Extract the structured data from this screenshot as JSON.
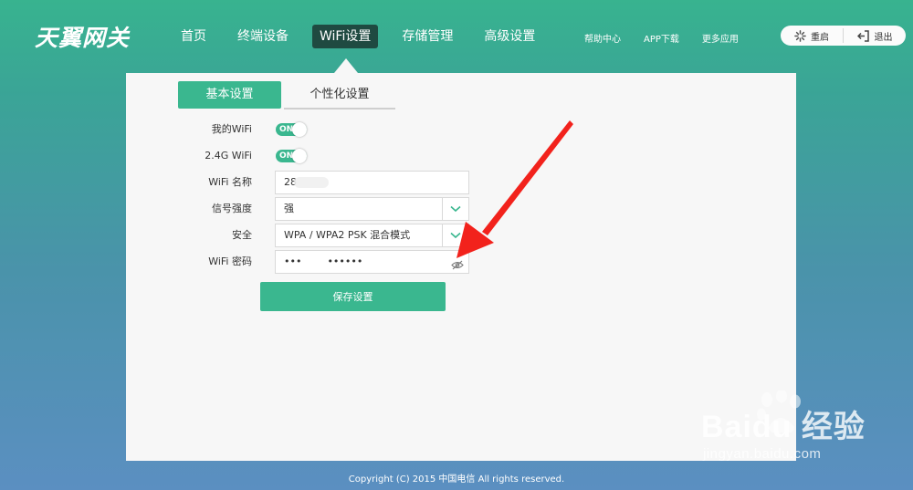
{
  "brand": {
    "logo_text": "天翼网关"
  },
  "nav": {
    "items": [
      {
        "label": "首页"
      },
      {
        "label": "终端设备"
      },
      {
        "label": "WiFi设置"
      },
      {
        "label": "存储管理"
      },
      {
        "label": "高级设置"
      }
    ],
    "active_index": 2
  },
  "top_links": [
    {
      "label": "帮助中心"
    },
    {
      "label": "APP下载"
    },
    {
      "label": "更多应用"
    }
  ],
  "actions": {
    "restart": {
      "label": "重启",
      "icon": "spinner-icon"
    },
    "logout": {
      "label": "退出",
      "icon": "logout-icon"
    }
  },
  "tabs": [
    {
      "label": "基本设置",
      "active": true
    },
    {
      "label": "个性化设置",
      "active": false
    }
  ],
  "form": {
    "my_wifi": {
      "label": "我的WiFi",
      "toggle": "ON"
    },
    "wifi_24g": {
      "label": "2.4G WiFi",
      "toggle": "ON"
    },
    "wifi_name": {
      "label": "WiFi 名称",
      "value": "28"
    },
    "signal": {
      "label": "信号强度",
      "value": "强"
    },
    "security": {
      "label": "安全",
      "value": "WPA / WPA2 PSK 混合模式"
    },
    "password": {
      "label": "WiFi 密码",
      "value": "•••        ••••••",
      "icon": "eye-hidden-icon"
    },
    "save_label": "保存设置"
  },
  "watermark": {
    "main": "Baidu 经验",
    "sub": "jingyan.baidu.com"
  },
  "footer": {
    "copyright": "Copyright (C) 2015 中国电信 All rights reserved."
  },
  "colors": {
    "accent": "#3ab78f",
    "nav_active": "#1f4a41",
    "arrow": "#f2221c"
  }
}
